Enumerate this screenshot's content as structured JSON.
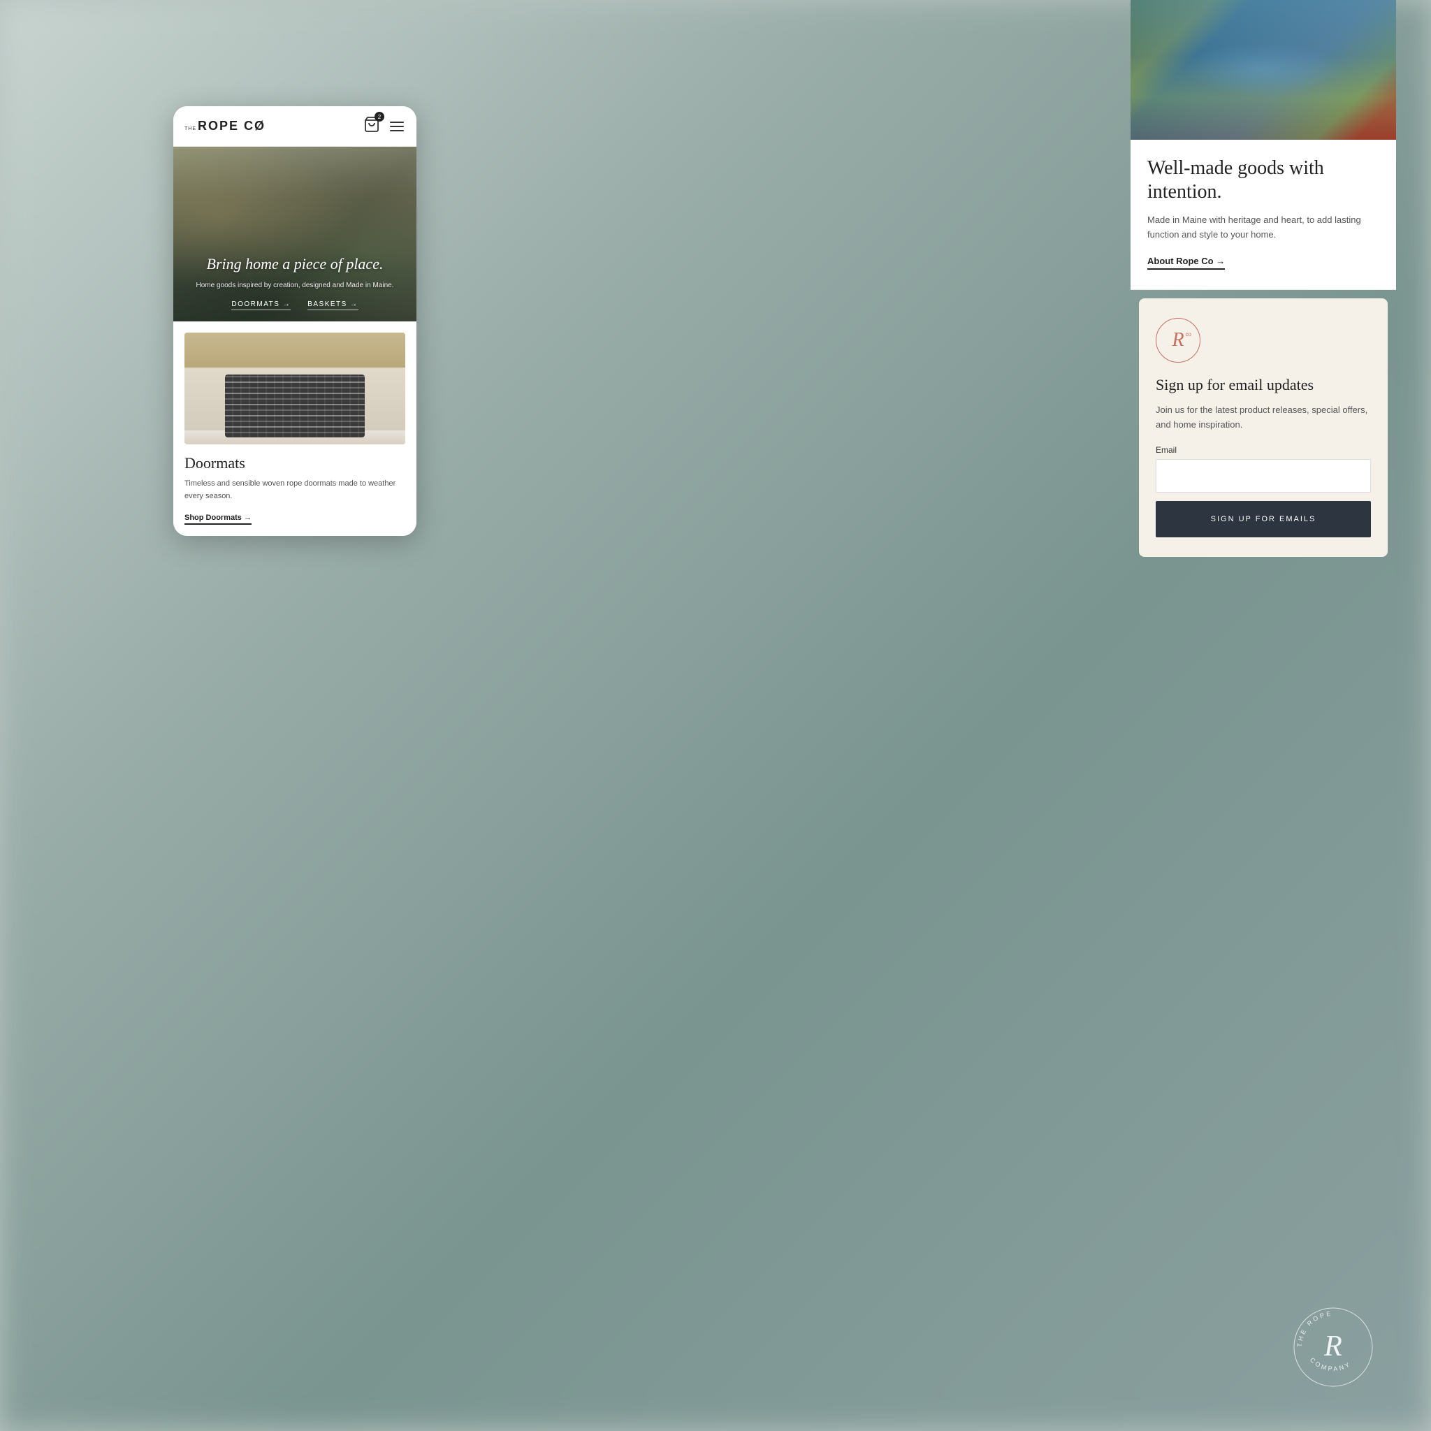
{
  "background": {
    "color": "#b0bfba"
  },
  "phone": {
    "header": {
      "logo_the": "THE",
      "logo_text": "ROPE CØ",
      "cart_count": "2"
    },
    "hero": {
      "title": "Bring home a piece of place.",
      "subtitle": "Home goods inspired by creation,\ndesigned and Made in Maine.",
      "btn_doormats": "DOORMATS →",
      "btn_baskets": "BASKETS →"
    },
    "product": {
      "title": "Doormats",
      "description": "Timeless and sensible woven rope doormats made to weather every season.",
      "shop_link": "Shop Doormats →"
    }
  },
  "right_panel": {
    "about": {
      "title": "Well-made goods with intention.",
      "description": "Made in Maine with heritage and heart, to add lasting function and style to your home.",
      "link_text": "About Rope Co →"
    },
    "email_signup": {
      "brand_r": "R",
      "brand_co": "co",
      "title": "Sign up for email updates",
      "description": "Join us for the latest product releases, special offers, and home inspiration.",
      "email_label": "Email",
      "email_placeholder": "",
      "button_text": "SIGN UP FOR EMAILS"
    }
  },
  "bottom_logo": {
    "text_arc_top": "THE ROPE",
    "text_arc_bottom": "COMPANY",
    "center_letter": "R"
  }
}
